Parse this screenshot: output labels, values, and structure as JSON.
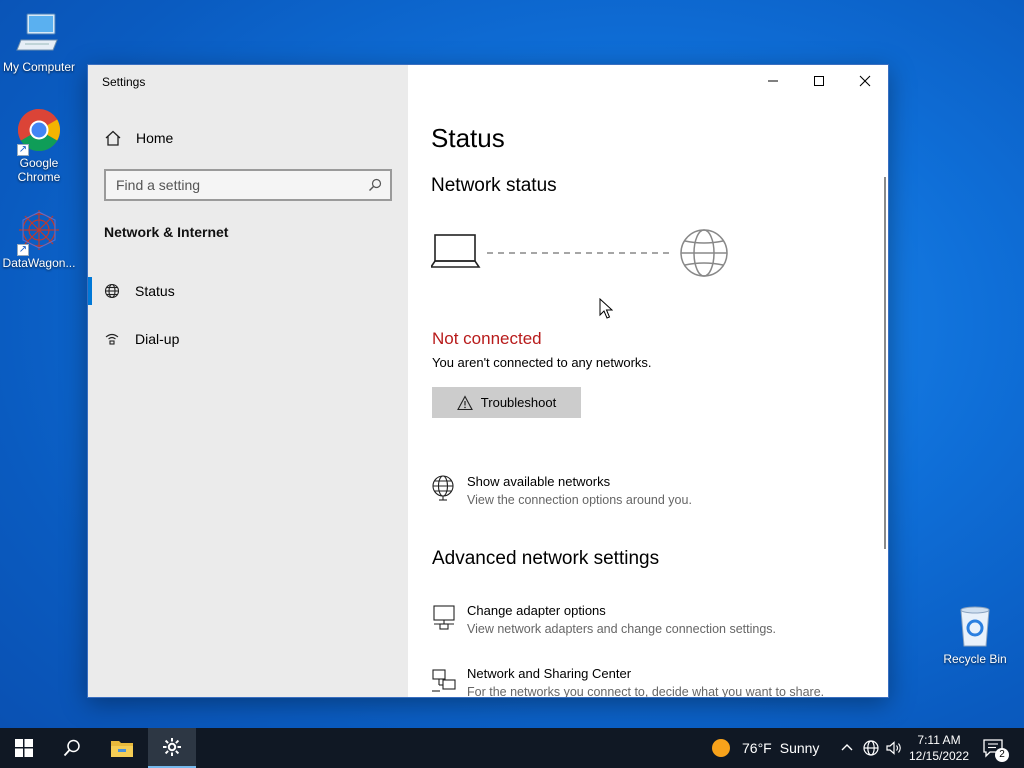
{
  "desktop": {
    "icons": [
      {
        "label": "My Computer",
        "icon": "computer-icon"
      },
      {
        "label": "Google Chrome",
        "icon": "chrome-icon"
      },
      {
        "label": "DataWagon...",
        "icon": "datawagon-icon"
      },
      {
        "label": "Recycle Bin",
        "icon": "recycle-bin-icon"
      }
    ]
  },
  "window": {
    "title": "Settings",
    "controls": [
      "minimize",
      "maximize",
      "close"
    ],
    "sidebar": {
      "home_label": "Home",
      "search_placeholder": "Find a setting",
      "section_title": "Network & Internet",
      "items": [
        {
          "label": "Status",
          "icon": "globe-icon",
          "active": true
        },
        {
          "label": "Dial-up",
          "icon": "dialup-icon",
          "active": false
        }
      ]
    },
    "main": {
      "title": "Status",
      "network_status_heading": "Network status",
      "status_text": "Not connected",
      "status_description": "You aren't connected to any networks.",
      "troubleshoot_label": "Troubleshoot",
      "show_networks": {
        "title": "Show available networks",
        "description": "View the connection options around you."
      },
      "advanced_heading": "Advanced network settings",
      "adapter_options": {
        "title": "Change adapter options",
        "description": "View network adapters and change connection settings."
      },
      "sharing_center": {
        "title": "Network and Sharing Center",
        "description": "For the networks you connect to, decide what you want to share."
      }
    }
  },
  "taskbar": {
    "weather": {
      "temp": "76°F",
      "condition": "Sunny"
    },
    "clock": {
      "time": "7:11 AM",
      "date": "12/15/2022"
    },
    "notification_count": "2"
  },
  "colors": {
    "accent": "#0078d7",
    "error": "#b81b1b",
    "desktop": "#0f6fd8",
    "taskbar": "#101824"
  }
}
